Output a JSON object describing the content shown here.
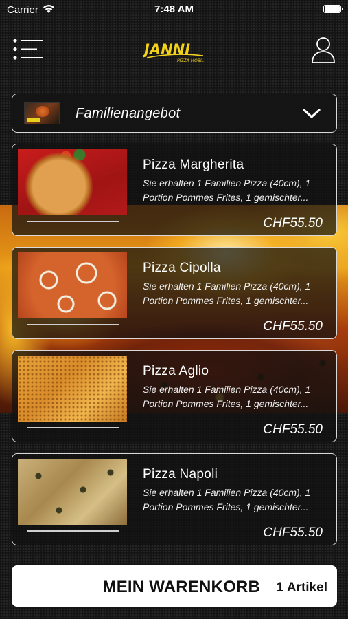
{
  "status_bar": {
    "carrier": "Carrier",
    "time": "7:48 AM"
  },
  "header": {
    "logo_text": "JANNI",
    "logo_subtext": "PIZZA-MOBIL",
    "menu_icon": "hamburger-menu-icon",
    "user_icon": "user-icon"
  },
  "category": {
    "selected": "Familienangebot"
  },
  "products": [
    {
      "name": "Pizza Margherita",
      "desc_line1": "Sie erhalten 1 Familien Pizza (40cm), 1",
      "desc_line2": "Portion Pommes Frites, 1 gemischter...",
      "price": "CHF55.50"
    },
    {
      "name": "Pizza Cipolla",
      "desc_line1": "Sie erhalten 1 Familien Pizza (40cm), 1",
      "desc_line2": "Portion Pommes Frites, 1 gemischter...",
      "price": "CHF55.50"
    },
    {
      "name": "Pizza Aglio",
      "desc_line1": "Sie erhalten 1 Familien Pizza (40cm), 1",
      "desc_line2": "Portion Pommes Frites, 1 gemischter...",
      "price": "CHF55.50"
    },
    {
      "name": "Pizza Napoli",
      "desc_line1": "Sie erhalten 1 Familien Pizza (40cm), 1",
      "desc_line2": "Portion Pommes Frites, 1 gemischter...",
      "price": "CHF55.50"
    }
  ],
  "cart": {
    "label": "MEIN WARENKORB",
    "count": "1 Artikel"
  },
  "colors": {
    "background": "#141414",
    "logo_yellow": "#f2d21a",
    "card_border": "#d9d9d9",
    "cart_bg": "#ffffff"
  }
}
